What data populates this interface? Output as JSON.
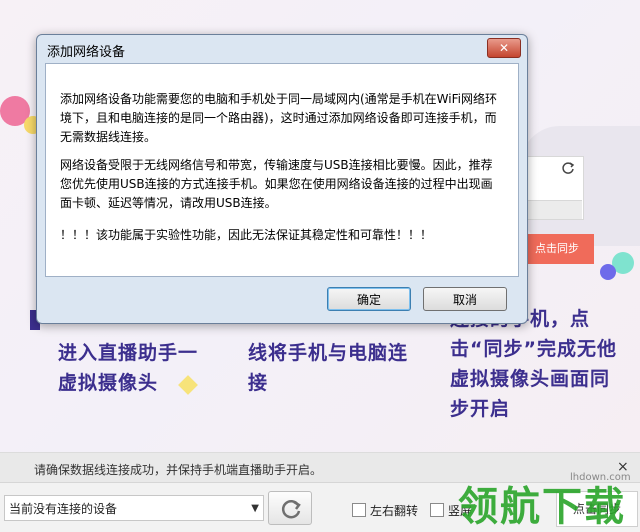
{
  "dialog": {
    "title": "添加网络设备",
    "close_label": "✕",
    "message_1": "添加网络设备功能需要您的电脑和手机处于同一局域网内(通常是手机在WiFi网络环境下，且和电脑连接的是同一个路由器)，这时通过添加网络设备即可连接手机，而无需数据线连接。",
    "message_2": "网络设备受限于无线网络信号和带宽，传输速度与USB连接相比要慢。因此，推荐您优先使用USB连接的方式连接手机。如果您在使用网络设备连接的过程中出现画面卡顿、延迟等情况，请改用USB连接。",
    "message_3": "！！！该功能属于实验性功能，因此无法保证其稳定性和可靠性！！！",
    "ok_label": "确定",
    "cancel_label": "取消"
  },
  "background": {
    "step_1_text": "进入直播助手一虚拟摄像头",
    "step_2_text": "线将手机与电脑连接",
    "step_3_text": "连接的手机，点击“同步”完成无他虚拟摄像头画面同步开启",
    "sync_button_label": "点击同步"
  },
  "status_bar": {
    "message": "请确保数据线连接成功，并保持手机端直播助手开启。",
    "close_label": "×"
  },
  "toolbar": {
    "device_select_value": "当前没有连接的设备",
    "flip_lr_label": "左右翻转",
    "vertical_label": "竖屏",
    "sync_label": "点击同步"
  },
  "watermark": {
    "text": "领航下载",
    "url": "lhdown.com"
  },
  "icons": {
    "refresh": "refresh-icon",
    "close": "close-icon",
    "dropdown": "chevron-down-icon"
  }
}
